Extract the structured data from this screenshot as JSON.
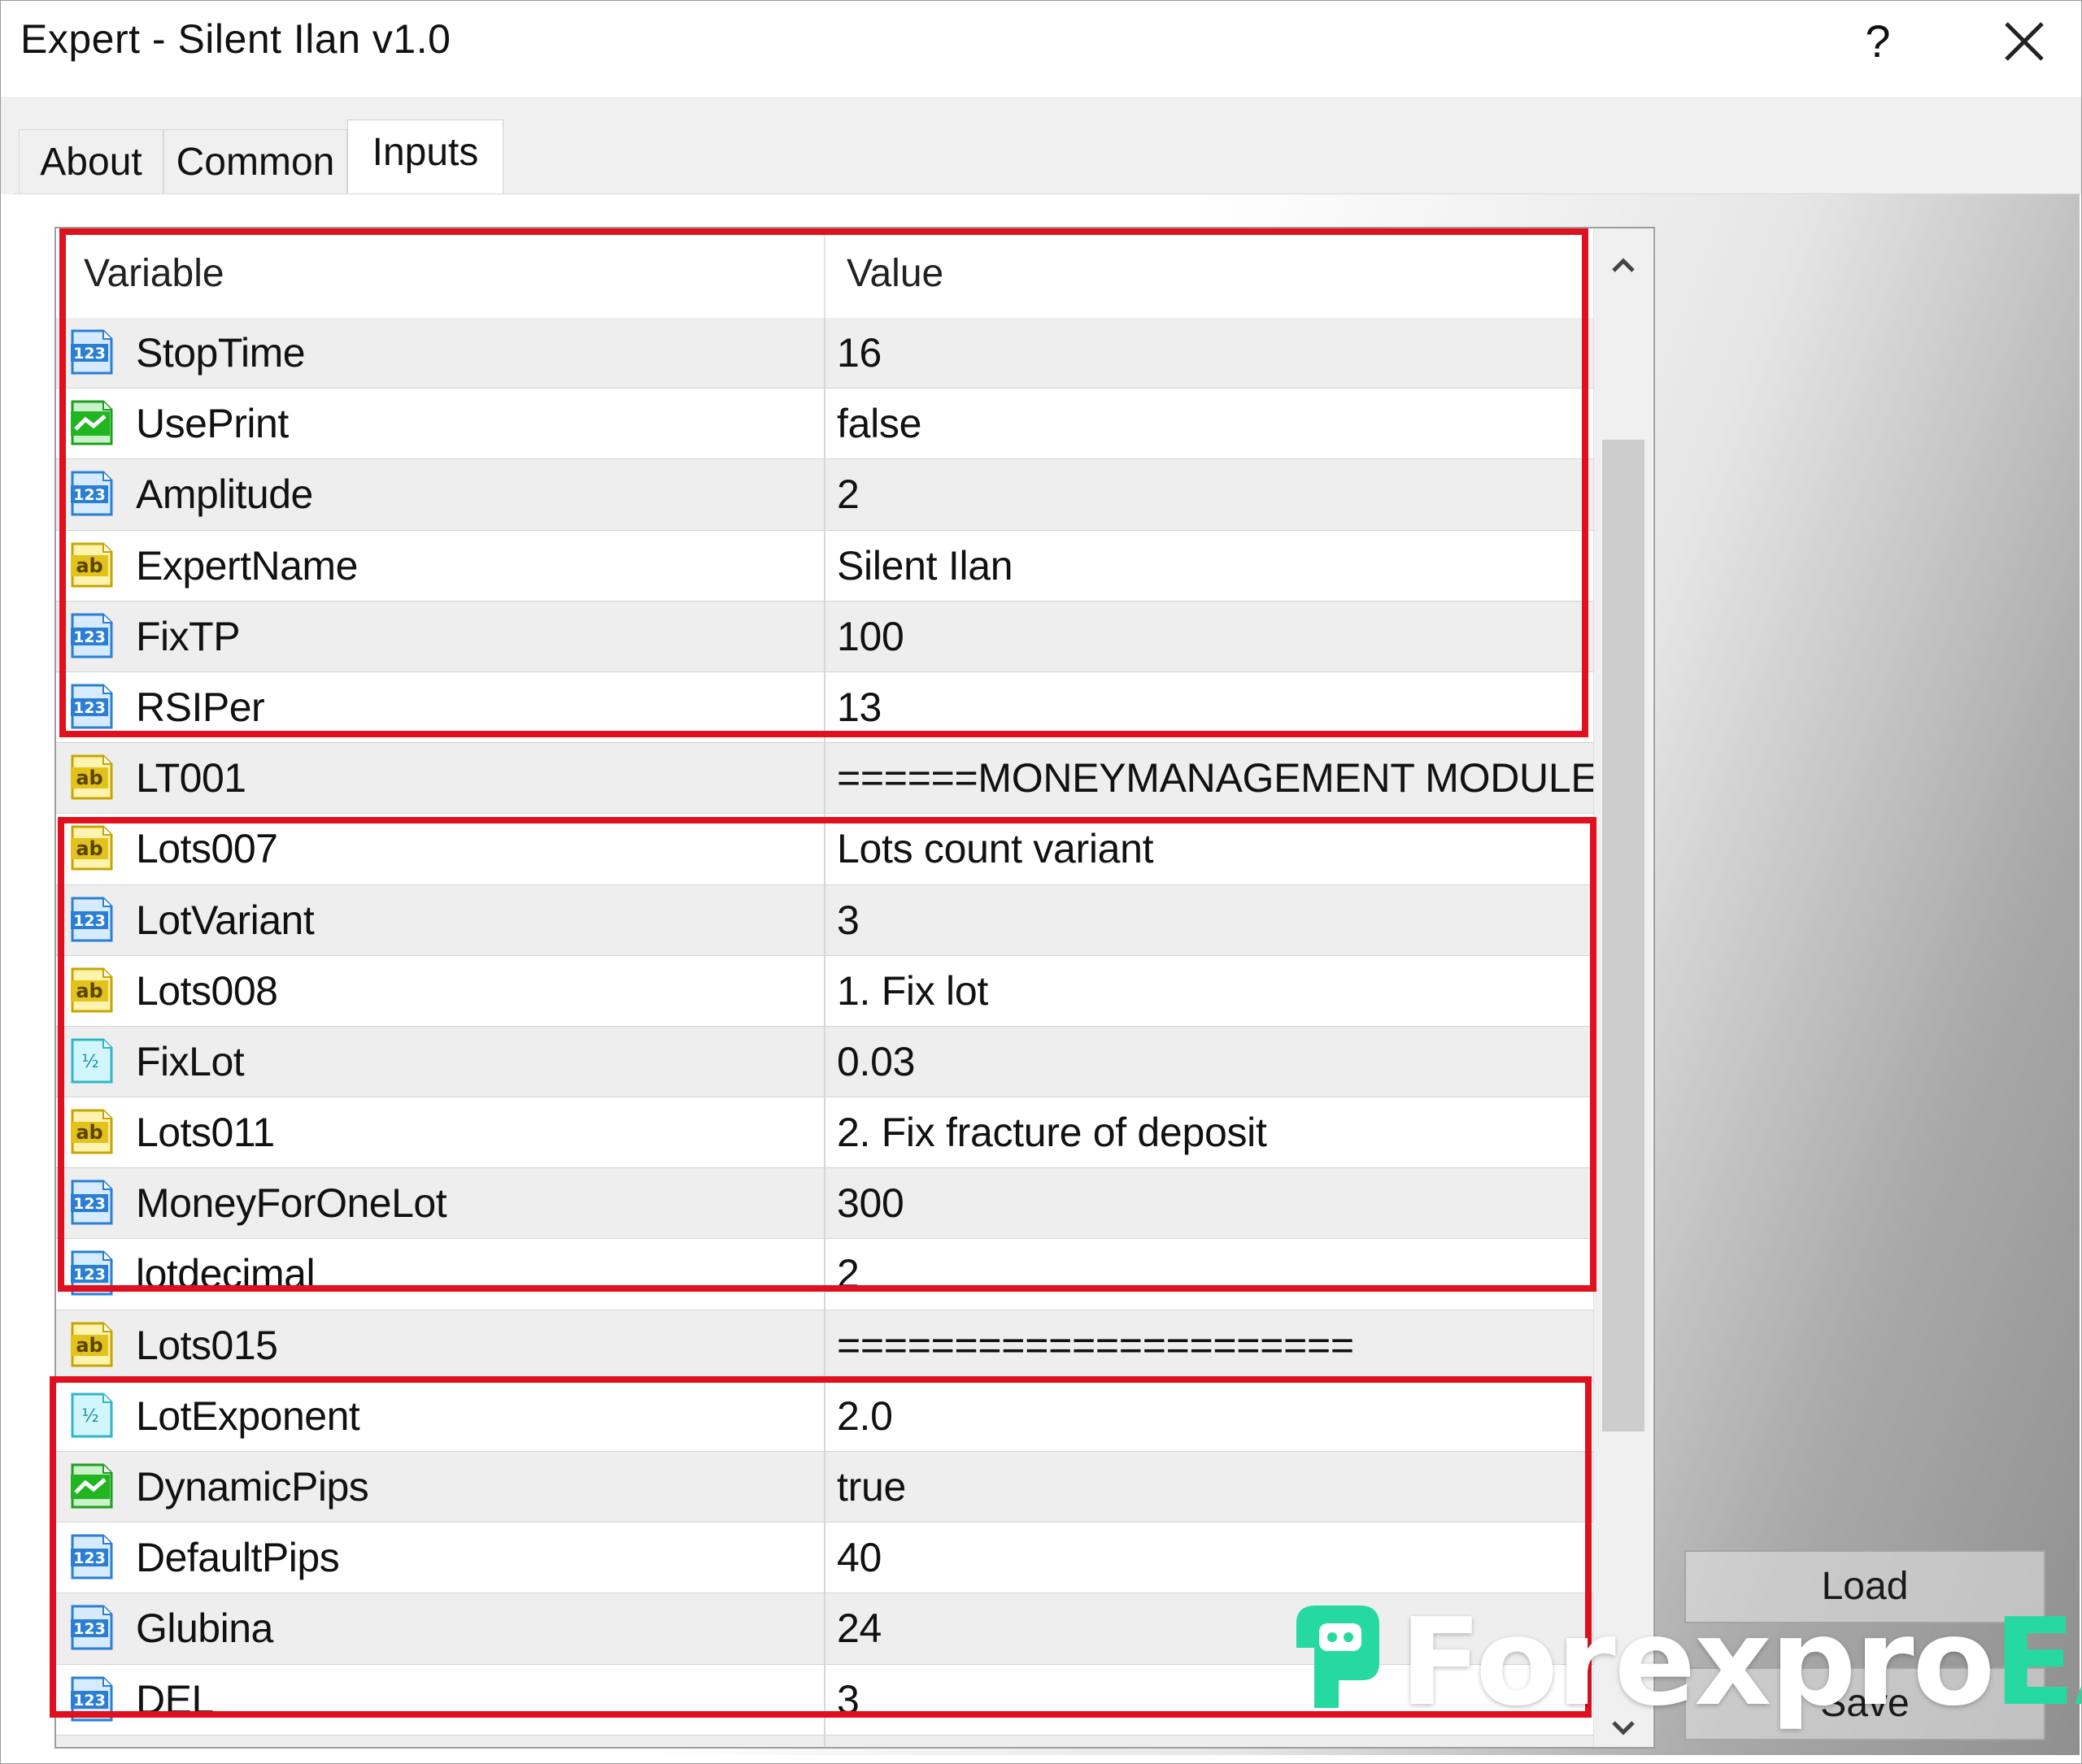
{
  "window": {
    "title": "Expert - Silent Ilan v1.0",
    "help_label": "?"
  },
  "tabs": [
    {
      "label": "About",
      "active": false
    },
    {
      "label": "Common",
      "active": false
    },
    {
      "label": "Inputs",
      "active": true
    }
  ],
  "grid": {
    "header": {
      "variable": "Variable",
      "value": "Value"
    },
    "rows": [
      {
        "icon": "integer-icon",
        "name": "StopTime",
        "value": "16"
      },
      {
        "icon": "bool-icon",
        "name": "UsePrint",
        "value": "false"
      },
      {
        "icon": "integer-icon",
        "name": "Amplitude",
        "value": "2"
      },
      {
        "icon": "string-icon",
        "name": "ExpertName",
        "value": "Silent Ilan"
      },
      {
        "icon": "integer-icon",
        "name": "FixTP",
        "value": "100"
      },
      {
        "icon": "integer-icon",
        "name": "RSIPer",
        "value": "13"
      },
      {
        "icon": "string-icon",
        "name": "LT001",
        "value": "======MONEYMANAGEMENT MODULE..."
      },
      {
        "icon": "string-icon",
        "name": "Lots007",
        "value": "Lots count variant"
      },
      {
        "icon": "integer-icon",
        "name": "LotVariant",
        "value": "3"
      },
      {
        "icon": "string-icon",
        "name": "Lots008",
        "value": "1. Fix lot"
      },
      {
        "icon": "double-icon",
        "name": "FixLot",
        "value": "0.03"
      },
      {
        "icon": "string-icon",
        "name": "Lots011",
        "value": "2. Fix fracture of deposit"
      },
      {
        "icon": "integer-icon",
        "name": "MoneyForOneLot",
        "value": "300"
      },
      {
        "icon": "integer-icon",
        "name": "lotdecimal",
        "value": "2"
      },
      {
        "icon": "string-icon",
        "name": "Lots015",
        "value": "======================"
      },
      {
        "icon": "double-icon",
        "name": "LotExponent",
        "value": "2.0"
      },
      {
        "icon": "bool-icon",
        "name": "DynamicPips",
        "value": "true"
      },
      {
        "icon": "integer-icon",
        "name": "DefaultPips",
        "value": "40"
      },
      {
        "icon": "integer-icon",
        "name": "Glubina",
        "value": "24"
      },
      {
        "icon": "integer-icon",
        "name": "DEL",
        "value": "3"
      }
    ]
  },
  "buttons": {
    "load": "Load",
    "save": "Save"
  },
  "watermark": {
    "part1": "Forexpro",
    "part2": "EA"
  },
  "colors": {
    "highlight": "#e0101e",
    "watermark_accent": "#26d9a1",
    "icon_integer": "#2a7fd4",
    "icon_string": "#e3c21c",
    "icon_bool": "#21b521",
    "icon_double": "#30b6c9"
  }
}
